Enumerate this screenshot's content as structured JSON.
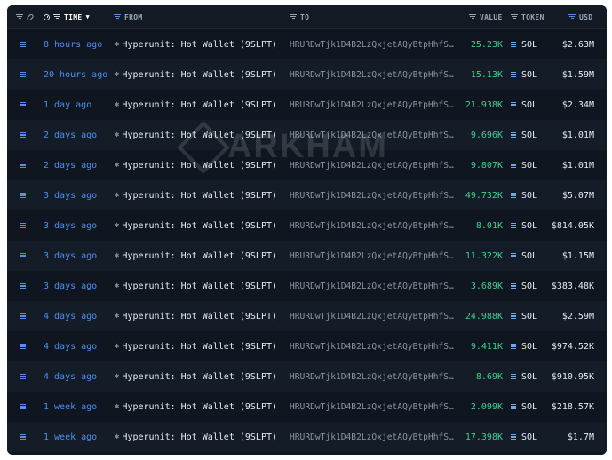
{
  "header": {
    "time": "TIME",
    "from": "FROM",
    "to": "TO",
    "value": "VALUE",
    "token": "TOKEN",
    "usd": "USD"
  },
  "watermark": "ARKHAM",
  "colors": {
    "accent": "#4d8ef0",
    "value_green": "#3fcf8e",
    "background": "#0f1620"
  },
  "rows": [
    {
      "time": "8 hours ago",
      "from": "Hyperunit: Hot Wallet (9SLPT)",
      "to": "HRURDwTjk1D4B2LzQxjetAQyBtpHhfS…",
      "value": "25.23K",
      "token": "SOL",
      "usd": "$2.63M"
    },
    {
      "time": "20 hours ago",
      "from": "Hyperunit: Hot Wallet (9SLPT)",
      "to": "HRURDwTjk1D4B2LzQxjetAQyBtpHhfS…",
      "value": "15.13K",
      "token": "SOL",
      "usd": "$1.59M"
    },
    {
      "time": "1 day ago",
      "from": "Hyperunit: Hot Wallet (9SLPT)",
      "to": "HRURDwTjk1D4B2LzQxjetAQyBtpHhfS…",
      "value": "21.938K",
      "token": "SOL",
      "usd": "$2.34M"
    },
    {
      "time": "2 days ago",
      "from": "Hyperunit: Hot Wallet (9SLPT)",
      "to": "HRURDwTjk1D4B2LzQxjetAQyBtpHhfS…",
      "value": "9.696K",
      "token": "SOL",
      "usd": "$1.01M"
    },
    {
      "time": "2 days ago",
      "from": "Hyperunit: Hot Wallet (9SLPT)",
      "to": "HRURDwTjk1D4B2LzQxjetAQyBtpHhfS…",
      "value": "9.807K",
      "token": "SOL",
      "usd": "$1.01M"
    },
    {
      "time": "3 days ago",
      "from": "Hyperunit: Hot Wallet (9SLPT)",
      "to": "HRURDwTjk1D4B2LzQxjetAQyBtpHhfS…",
      "value": "49.732K",
      "token": "SOL",
      "usd": "$5.07M"
    },
    {
      "time": "3 days ago",
      "from": "Hyperunit: Hot Wallet (9SLPT)",
      "to": "HRURDwTjk1D4B2LzQxjetAQyBtpHhfS…",
      "value": "8.01K",
      "token": "SOL",
      "usd": "$814.05K"
    },
    {
      "time": "3 days ago",
      "from": "Hyperunit: Hot Wallet (9SLPT)",
      "to": "HRURDwTjk1D4B2LzQxjetAQyBtpHhfS…",
      "value": "11.322K",
      "token": "SOL",
      "usd": "$1.15M"
    },
    {
      "time": "3 days ago",
      "from": "Hyperunit: Hot Wallet (9SLPT)",
      "to": "HRURDwTjk1D4B2LzQxjetAQyBtpHhfS…",
      "value": "3.689K",
      "token": "SOL",
      "usd": "$383.48K"
    },
    {
      "time": "4 days ago",
      "from": "Hyperunit: Hot Wallet (9SLPT)",
      "to": "HRURDwTjk1D4B2LzQxjetAQyBtpHhfS…",
      "value": "24.988K",
      "token": "SOL",
      "usd": "$2.59M"
    },
    {
      "time": "4 days ago",
      "from": "Hyperunit: Hot Wallet (9SLPT)",
      "to": "HRURDwTjk1D4B2LzQxjetAQyBtpHhfS…",
      "value": "9.411K",
      "token": "SOL",
      "usd": "$974.52K"
    },
    {
      "time": "4 days ago",
      "from": "Hyperunit: Hot Wallet (9SLPT)",
      "to": "HRURDwTjk1D4B2LzQxjetAQyBtpHhfS…",
      "value": "8.69K",
      "token": "SOL",
      "usd": "$910.95K"
    },
    {
      "time": "1 week ago",
      "from": "Hyperunit: Hot Wallet (9SLPT)",
      "to": "HRURDwTjk1D4B2LzQxjetAQyBtpHhfS…",
      "value": "2.099K",
      "token": "SOL",
      "usd": "$218.57K"
    },
    {
      "time": "1 week ago",
      "from": "Hyperunit: Hot Wallet (9SLPT)",
      "to": "HRURDwTjk1D4B2LzQxjetAQyBtpHhfS…",
      "value": "17.398K",
      "token": "SOL",
      "usd": "$1.7M"
    }
  ]
}
